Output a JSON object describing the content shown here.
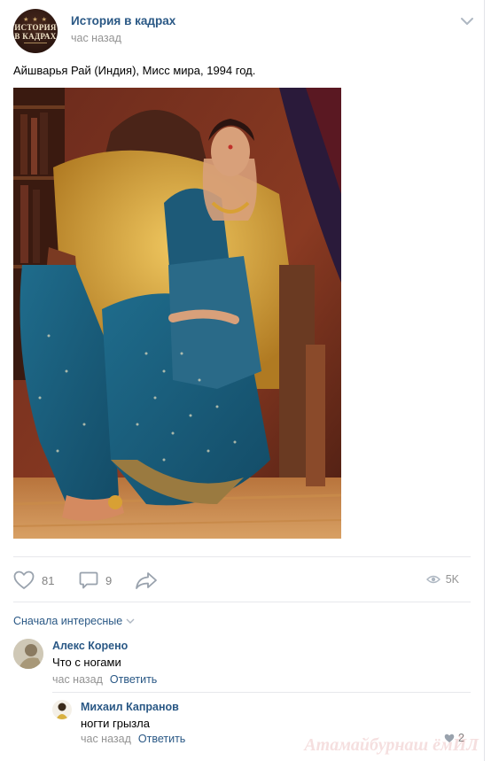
{
  "post": {
    "group_name": "История в кадрах",
    "time": "час назад",
    "avatar_text_line1": "ИСТОРИЯ",
    "avatar_text_line2": "В КАДРАХ",
    "text": "Айшварья Рай (Индия), Мисс мира, 1994 год."
  },
  "actions": {
    "likes": "81",
    "comments": "9",
    "views": "5K"
  },
  "comments_section": {
    "sort_label": "Сначала интересные"
  },
  "comments": [
    {
      "author": "Алекс Корено",
      "text": "Что с ногами",
      "time": "час назад",
      "reply": "Ответить"
    },
    {
      "author": "Михаил Капранов",
      "text": "ногти грызла",
      "time": "час назад",
      "reply": "Ответить",
      "likes": "2"
    }
  ],
  "watermark": "Атамайбурнаш ёмЙЛ"
}
